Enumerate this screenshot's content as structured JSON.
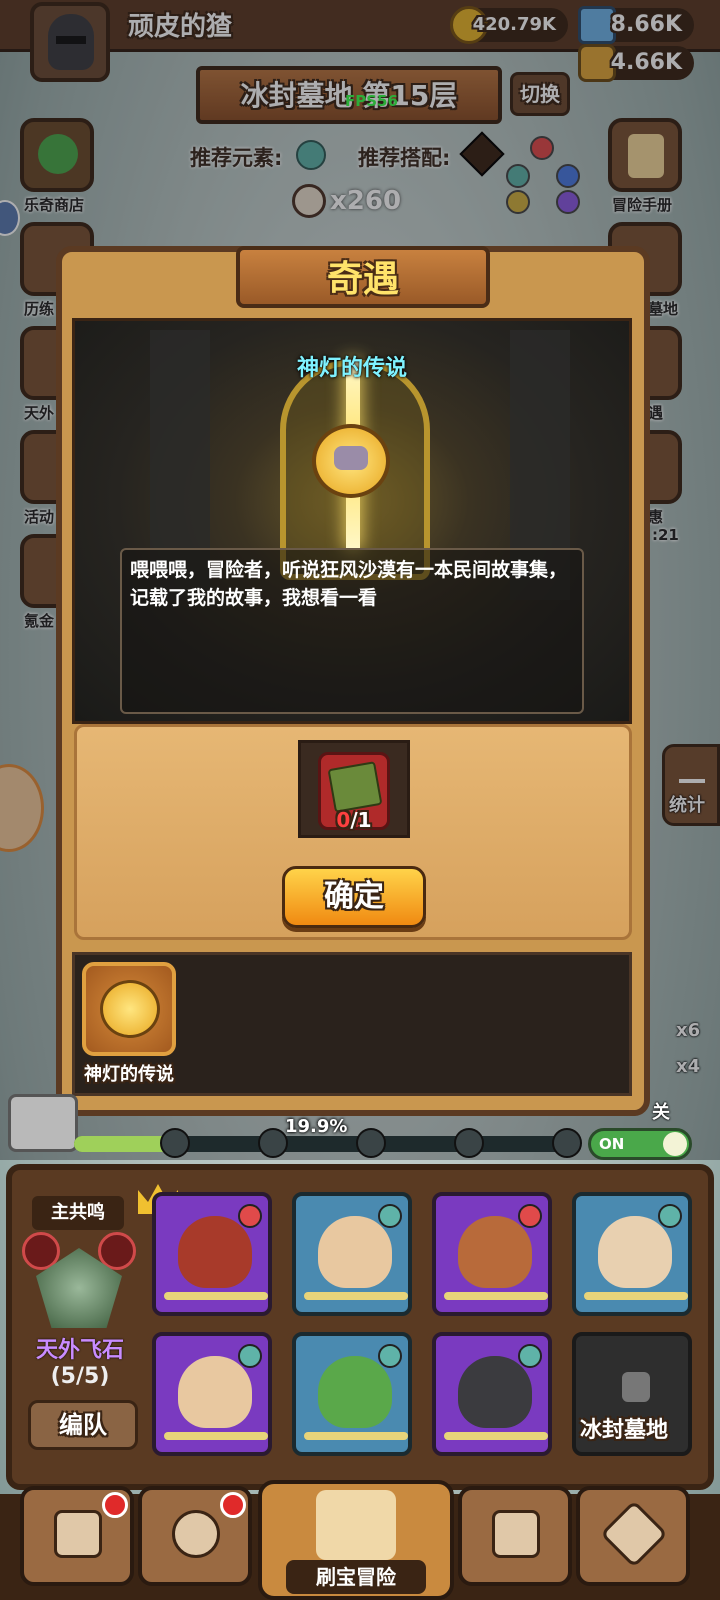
{
  "player": {
    "name": "顽皮的猹"
  },
  "resources": {
    "gold": "420.79K",
    "crystal": "8.66K",
    "potion": "4.66K"
  },
  "level": {
    "title": "冰封墓地 第15层",
    "switch_label": "切换",
    "fps": "FPS56"
  },
  "recommend": {
    "element_label": "推荐元素:",
    "combo_label": "推荐搭配:"
  },
  "skull_count": "x260",
  "left_menu": [
    {
      "label": "乐奇商店"
    },
    {
      "label": "历练"
    },
    {
      "label": "天外"
    },
    {
      "label": "活动"
    },
    {
      "label": "氪金"
    }
  ],
  "right_menu": [
    {
      "label": "冒险手册"
    },
    {
      "label": "墓地"
    },
    {
      "label": "遇"
    },
    {
      "label": "惠"
    },
    {
      "label": "统计"
    }
  ],
  "right_counts": {
    "timer": ":21",
    "c1": "x6",
    "c2": "x4"
  },
  "modal": {
    "title": "奇遇",
    "event_name": "神灯的传说",
    "dialog": "喂喂喂，冒险者，听说狂风沙漠有一本民间故事集，记载了我的故事，我想看一看",
    "item": {
      "have": "0",
      "need": "/1"
    },
    "confirm_label": "确定",
    "history": [
      {
        "label": "神灯的传说"
      }
    ]
  },
  "progress": {
    "text": "19.9%",
    "fraction": 0.199,
    "toggle_label": "ON",
    "right_label": "关"
  },
  "team": {
    "resonance_label": "主共鸣",
    "stone_name": "天外飞石",
    "stone_count": "(5/5)",
    "formation_label": "编队",
    "locked_label": "冰封墓地"
  },
  "nav": {
    "main_label": "刷宝冒险"
  },
  "colors": {
    "accent": "#f08a12",
    "panel": "#c9974f",
    "dark": "#3a2414",
    "cyan_title": "#7ff2ff"
  }
}
